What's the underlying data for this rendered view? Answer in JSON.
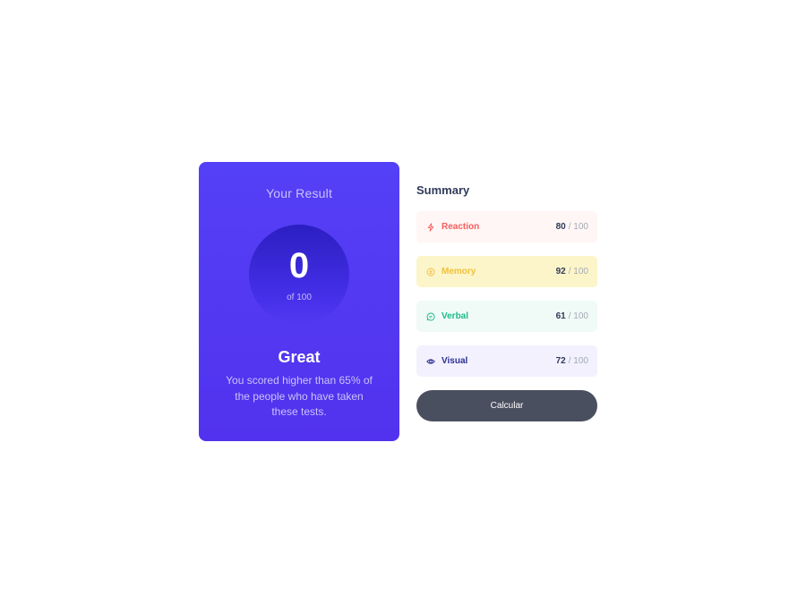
{
  "result": {
    "title": "Your Result",
    "score": "0",
    "score_max": "of 100",
    "grade": "Great",
    "description": "You scored higher than 65% of the people who have taken these tests."
  },
  "summary": {
    "title": "Summary",
    "items": [
      {
        "label": "Reaction",
        "score": "80",
        "max": "/ 100",
        "color": "#f55e5e",
        "icon": "lightning-icon"
      },
      {
        "label": "Memory",
        "score": "92",
        "max": "/ 100",
        "color": "#f0c03c",
        "icon": "brain-icon"
      },
      {
        "label": "Verbal",
        "score": "61",
        "max": "/ 100",
        "color": "#1cb98a",
        "icon": "chat-bubble-icon"
      },
      {
        "label": "Visual",
        "score": "72",
        "max": "/ 100",
        "color": "#2c2e91",
        "icon": "eye-icon"
      }
    ],
    "button_label": "Calcular"
  },
  "colors": {
    "card_bg": "#5232ee",
    "circle_bg": "#2b1fc1",
    "button_bg": "#4a4f5f"
  }
}
